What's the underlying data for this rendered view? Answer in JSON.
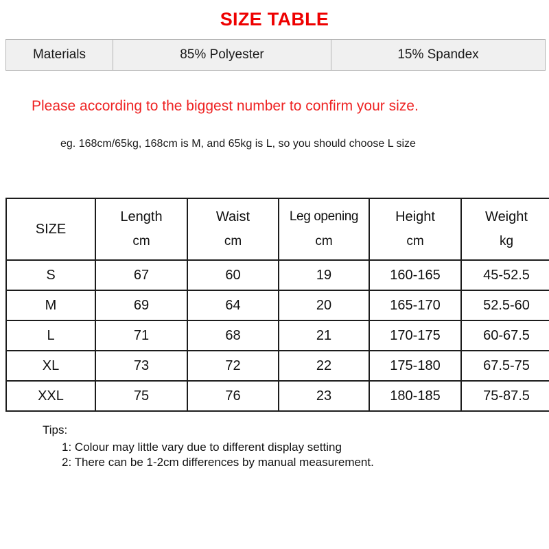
{
  "title": "SIZE TABLE",
  "materials": {
    "label": "Materials",
    "composition_1": "85% Polyester",
    "composition_2": "15% Spandex"
  },
  "notice": {
    "red_line": "Please according to the biggest number to confirm your size.",
    "example_line": "eg. 168cm/65kg, 168cm is M, and 65kg is L, so you should choose L size"
  },
  "size_table": {
    "headers": [
      {
        "name": "SIZE",
        "unit": ""
      },
      {
        "name": "Length",
        "unit": "cm"
      },
      {
        "name": "Waist",
        "unit": "cm"
      },
      {
        "name": "Leg opening",
        "unit": "cm"
      },
      {
        "name": "Height",
        "unit": "cm"
      },
      {
        "name": "Weight",
        "unit": "kg"
      }
    ],
    "rows": [
      {
        "size": "S",
        "length": "67",
        "waist": "60",
        "leg_opening": "19",
        "height": "160-165",
        "weight": "45-52.5"
      },
      {
        "size": "M",
        "length": "69",
        "waist": "64",
        "leg_opening": "20",
        "height": "165-170",
        "weight": "52.5-60"
      },
      {
        "size": "L",
        "length": "71",
        "waist": "68",
        "leg_opening": "21",
        "height": "170-175",
        "weight": "60-67.5"
      },
      {
        "size": "XL",
        "length": "73",
        "waist": "72",
        "leg_opening": "22",
        "height": "175-180",
        "weight": "67.5-75"
      },
      {
        "size": "XXL",
        "length": "75",
        "waist": "76",
        "leg_opening": "23",
        "height": "180-185",
        "weight": "75-87.5"
      }
    ]
  },
  "tips": {
    "heading": "Tips:",
    "items": [
      "1: Colour may little vary due to different display setting",
      "2: There can be 1-2cm differences by manual measurement."
    ]
  },
  "colors": {
    "title_red": "#ee0000",
    "notice_red": "#ee2222",
    "table_border": "#1c1c1c",
    "materials_background": "#f0f0f0",
    "materials_border": "#b4b4b4",
    "text": "#101010"
  }
}
